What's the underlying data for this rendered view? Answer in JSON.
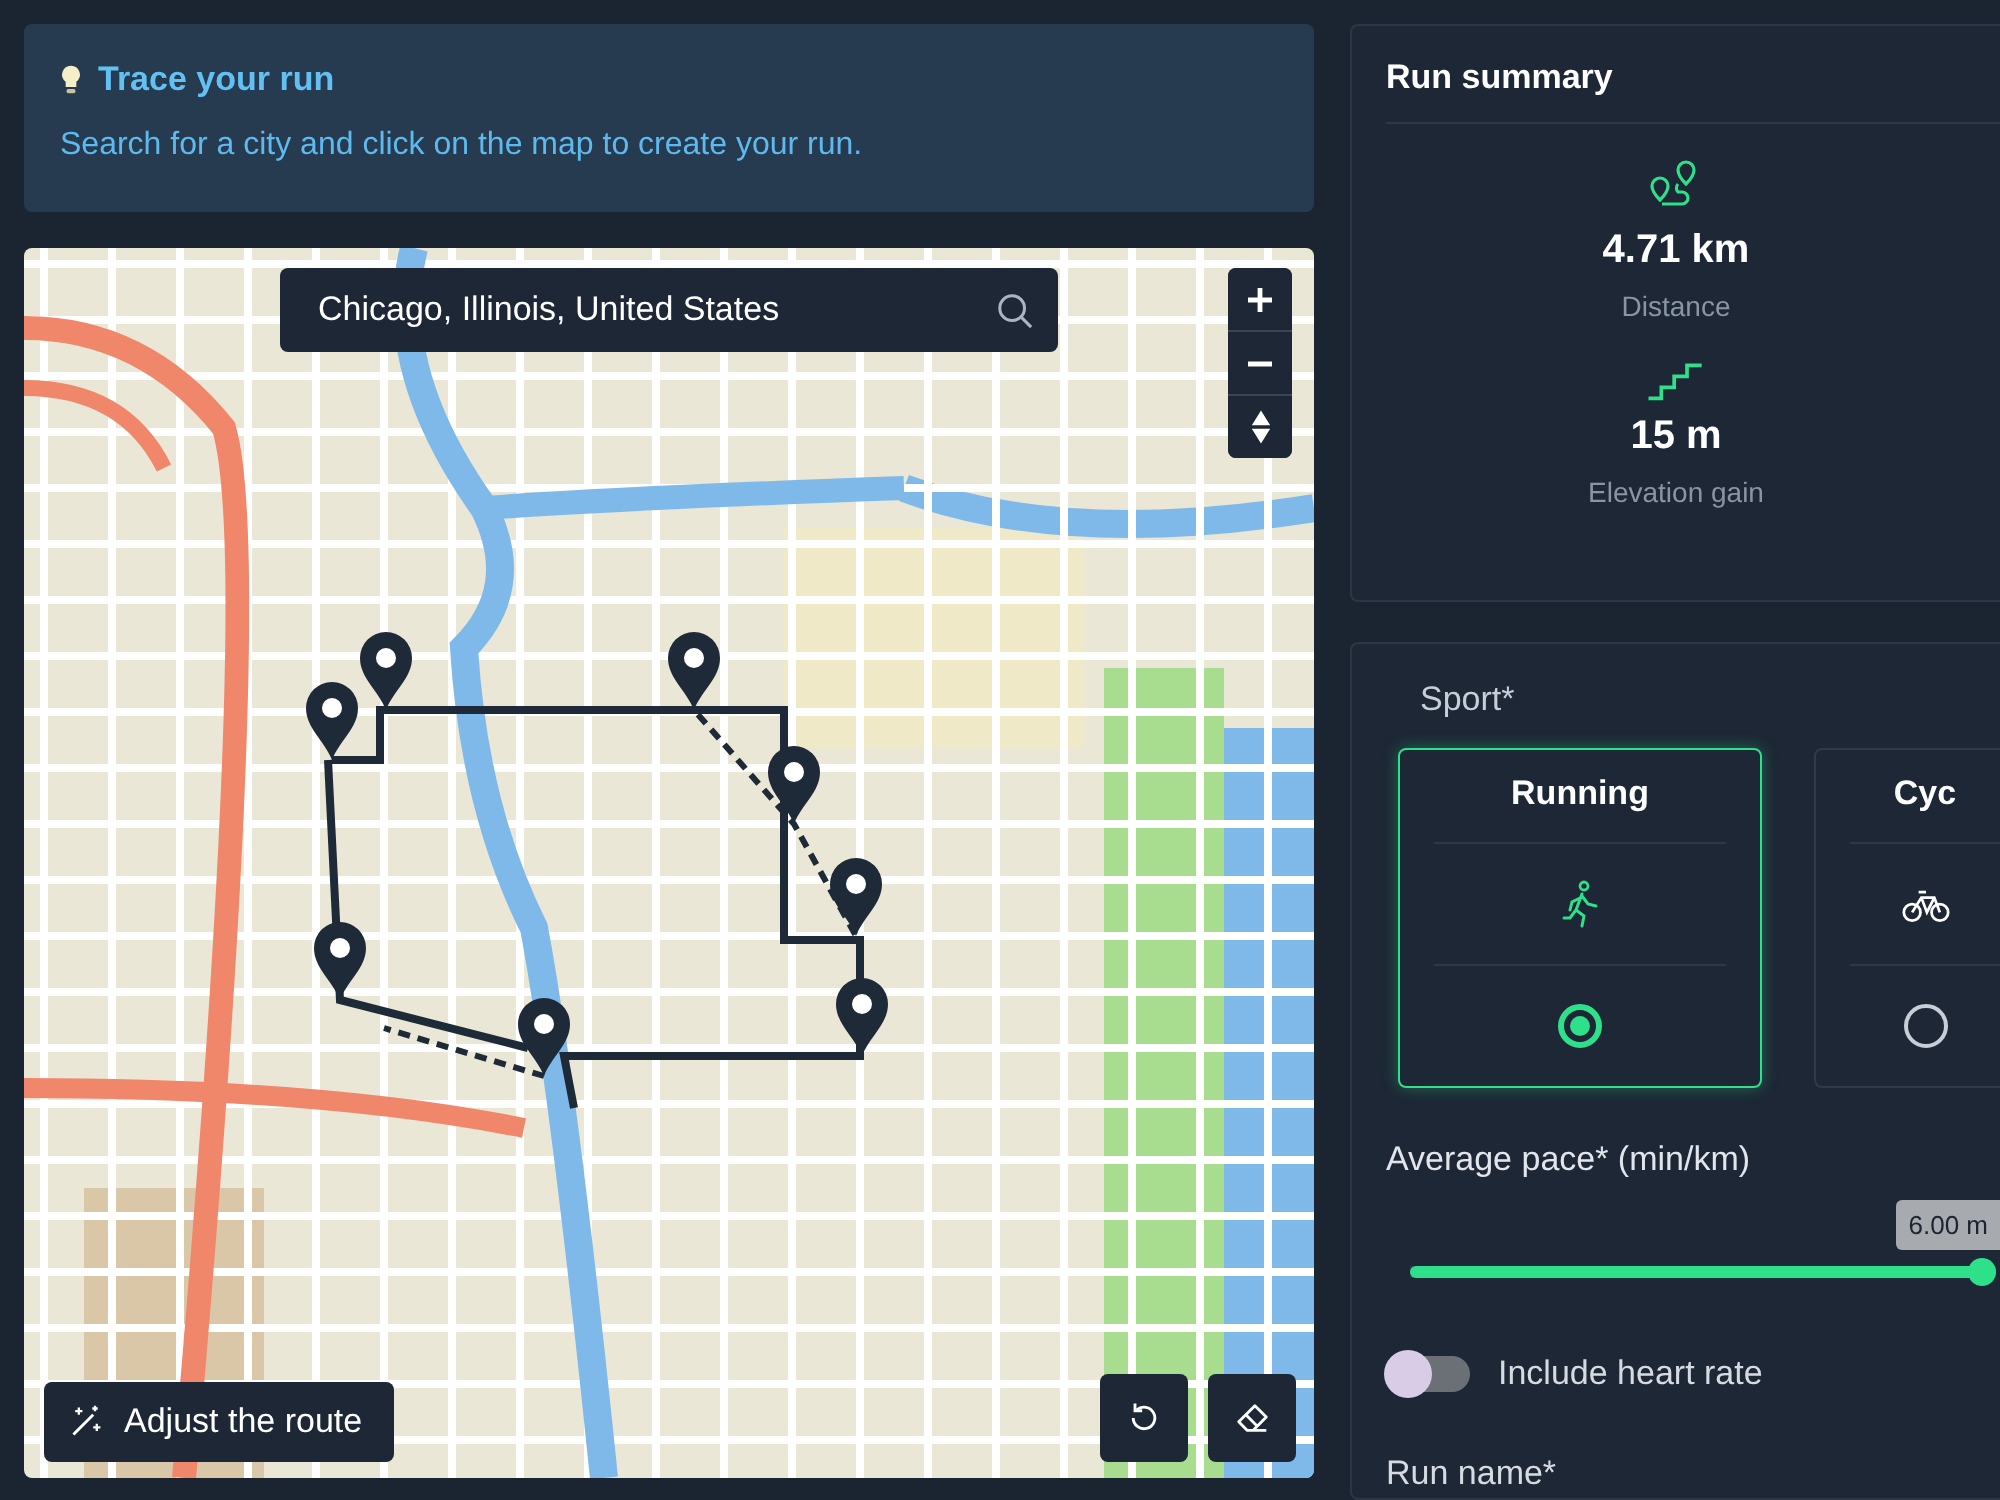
{
  "info": {
    "title": "Trace your run",
    "text": "Search for a city and click on the map to create your run."
  },
  "map": {
    "search": {
      "value": "Chicago, Illinois, United States"
    },
    "adjust_button": "Adjust the route"
  },
  "summary": {
    "title": "Run summary",
    "stats": [
      {
        "kind": "distance",
        "value": "4.71 km",
        "label": "Distance"
      },
      {
        "kind": "elevation",
        "value": "15 m",
        "label": "Elevation gain"
      }
    ]
  },
  "form": {
    "sport_label": "Sport*",
    "sports": [
      {
        "kind": "running",
        "label": "Running",
        "selected": true
      },
      {
        "kind": "cycling",
        "label": "Cyc",
        "selected": false
      }
    ],
    "pace": {
      "label": "Average pace* (min/km)",
      "level": 1,
      "reading": "6.00 m"
    },
    "heart_rate": {
      "label": "Include heart rate",
      "on": false
    },
    "run_name_label": "Run name*"
  }
}
